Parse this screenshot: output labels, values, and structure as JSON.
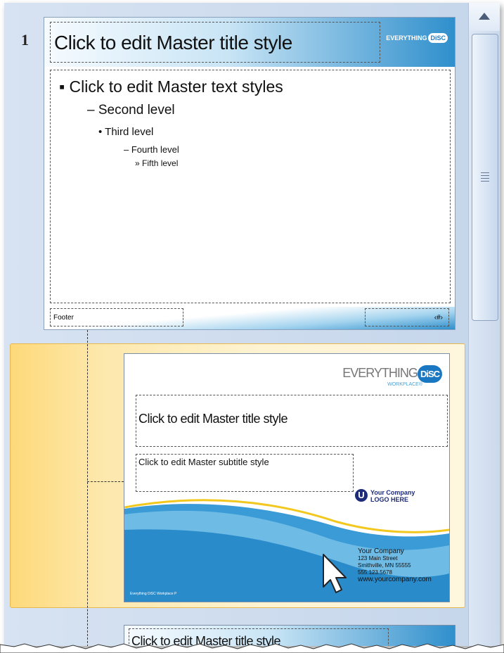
{
  "slide_list": {
    "slide_number": "1",
    "master": {
      "title": "Click to edit Master title style",
      "logo_text": "EVERYTHING",
      "logo_badge": "DiSC",
      "levels": [
        "Click to edit Master text styles",
        "Second level",
        "Third level",
        "Fourth level",
        "Fifth level"
      ],
      "level_bullets": [
        "▪",
        "–",
        "•",
        "–",
        "»"
      ],
      "footer": "Footer",
      "page_number": "‹#›"
    },
    "title_layout": {
      "logo_text": "EVERYTHING",
      "logo_badge": "DiSC",
      "logo_sub": "WORKPLACE®",
      "title": "Click to edit Master title style",
      "subtitle": "Click to edit Master  subtitle style",
      "company_logo_line1": "Your Company",
      "company_logo_line2": "LOGO HERE",
      "company_logo_letter": "U",
      "address": [
        "Your Company",
        "123 Main Street",
        "Smithville, MN 55555",
        "555.123.5678",
        "www.yourcompany.com"
      ],
      "footer_small": "Everything DiSC Workplace  P"
    },
    "next_layout": {
      "title": "Click to edit Master title style"
    }
  },
  "colors": {
    "selection": "#fde8ac",
    "accent_blue": "#2f8fcc",
    "pane_bg": "#c9d9ed"
  }
}
